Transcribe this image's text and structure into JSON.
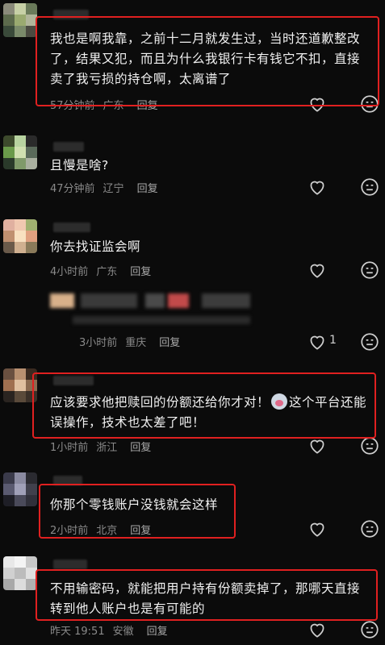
{
  "comments": [
    {
      "text": "我也是啊我靠，之前十二月就发生过，当时还道歉整改了，结果又犯，而且为什么我银行卡有钱它不扣，直接卖了我亏损的持仓啊，太离谱了",
      "time": "57分钟前",
      "location": "广东",
      "reply": "回复"
    },
    {
      "text": "且慢是啥?",
      "time": "47分钟前",
      "location": "辽宁",
      "reply": "回复"
    },
    {
      "text": "你去找证监会啊",
      "time": "4小时前",
      "location": "广东",
      "reply": "回复"
    },
    {
      "text": "",
      "time": "3小时前",
      "location": "重庆",
      "reply": "回复",
      "likes": "1"
    },
    {
      "text_a": "应该要求他把赎回的份额还给你才对！",
      "text_b": "这个平台还能误操作，技术也太差了吧！",
      "time": "1小时前",
      "location": "浙江",
      "reply": "回复"
    },
    {
      "text": "你那个零钱账户没钱就会这样",
      "time": "2小时前",
      "location": "北京",
      "reply": "回复"
    },
    {
      "text": "不用输密码，就能把用户持有份额卖掉了，那哪天直接转到他人账户也是有可能的",
      "time": "昨天 19:51",
      "location": "安徽",
      "reply": "回复"
    }
  ],
  "colors": {
    "highlight": "#e02020",
    "background": "#0b0b0b"
  },
  "icons": [
    "heart-outline-icon",
    "dislike-face-icon"
  ]
}
